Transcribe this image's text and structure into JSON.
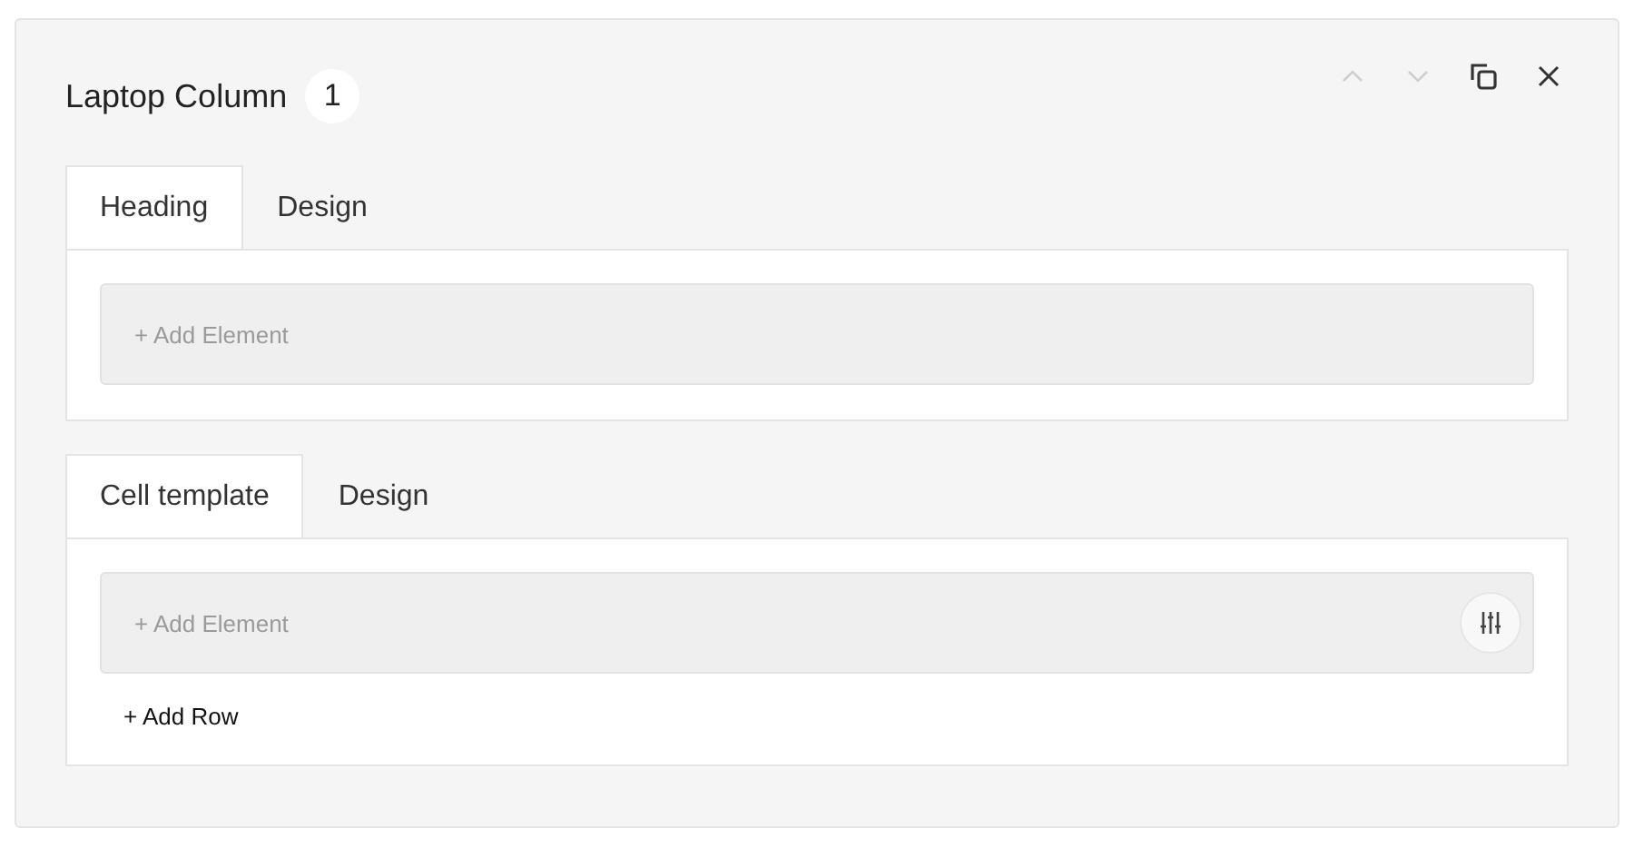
{
  "panel": {
    "title": "Laptop Column",
    "badge": "1",
    "actions": [
      {
        "kind": "up",
        "disabled": true
      },
      {
        "kind": "down",
        "disabled": true
      },
      {
        "kind": "copy",
        "disabled": false
      },
      {
        "kind": "close",
        "disabled": false
      }
    ]
  },
  "sections": [
    {
      "tabs": [
        {
          "label": "Heading",
          "selected": true
        },
        {
          "label": "Design",
          "selected": false
        }
      ],
      "element_slot": {
        "label": "+ Add Element"
      }
    },
    {
      "tabs": [
        {
          "label": "Cell template",
          "selected": true
        },
        {
          "label": "Design",
          "selected": false
        }
      ],
      "element_slot": {
        "label": "+ Add Element",
        "tools": [
          {
            "kind": "settings"
          }
        ]
      },
      "add_row": "+ Add Row"
    }
  ]
}
